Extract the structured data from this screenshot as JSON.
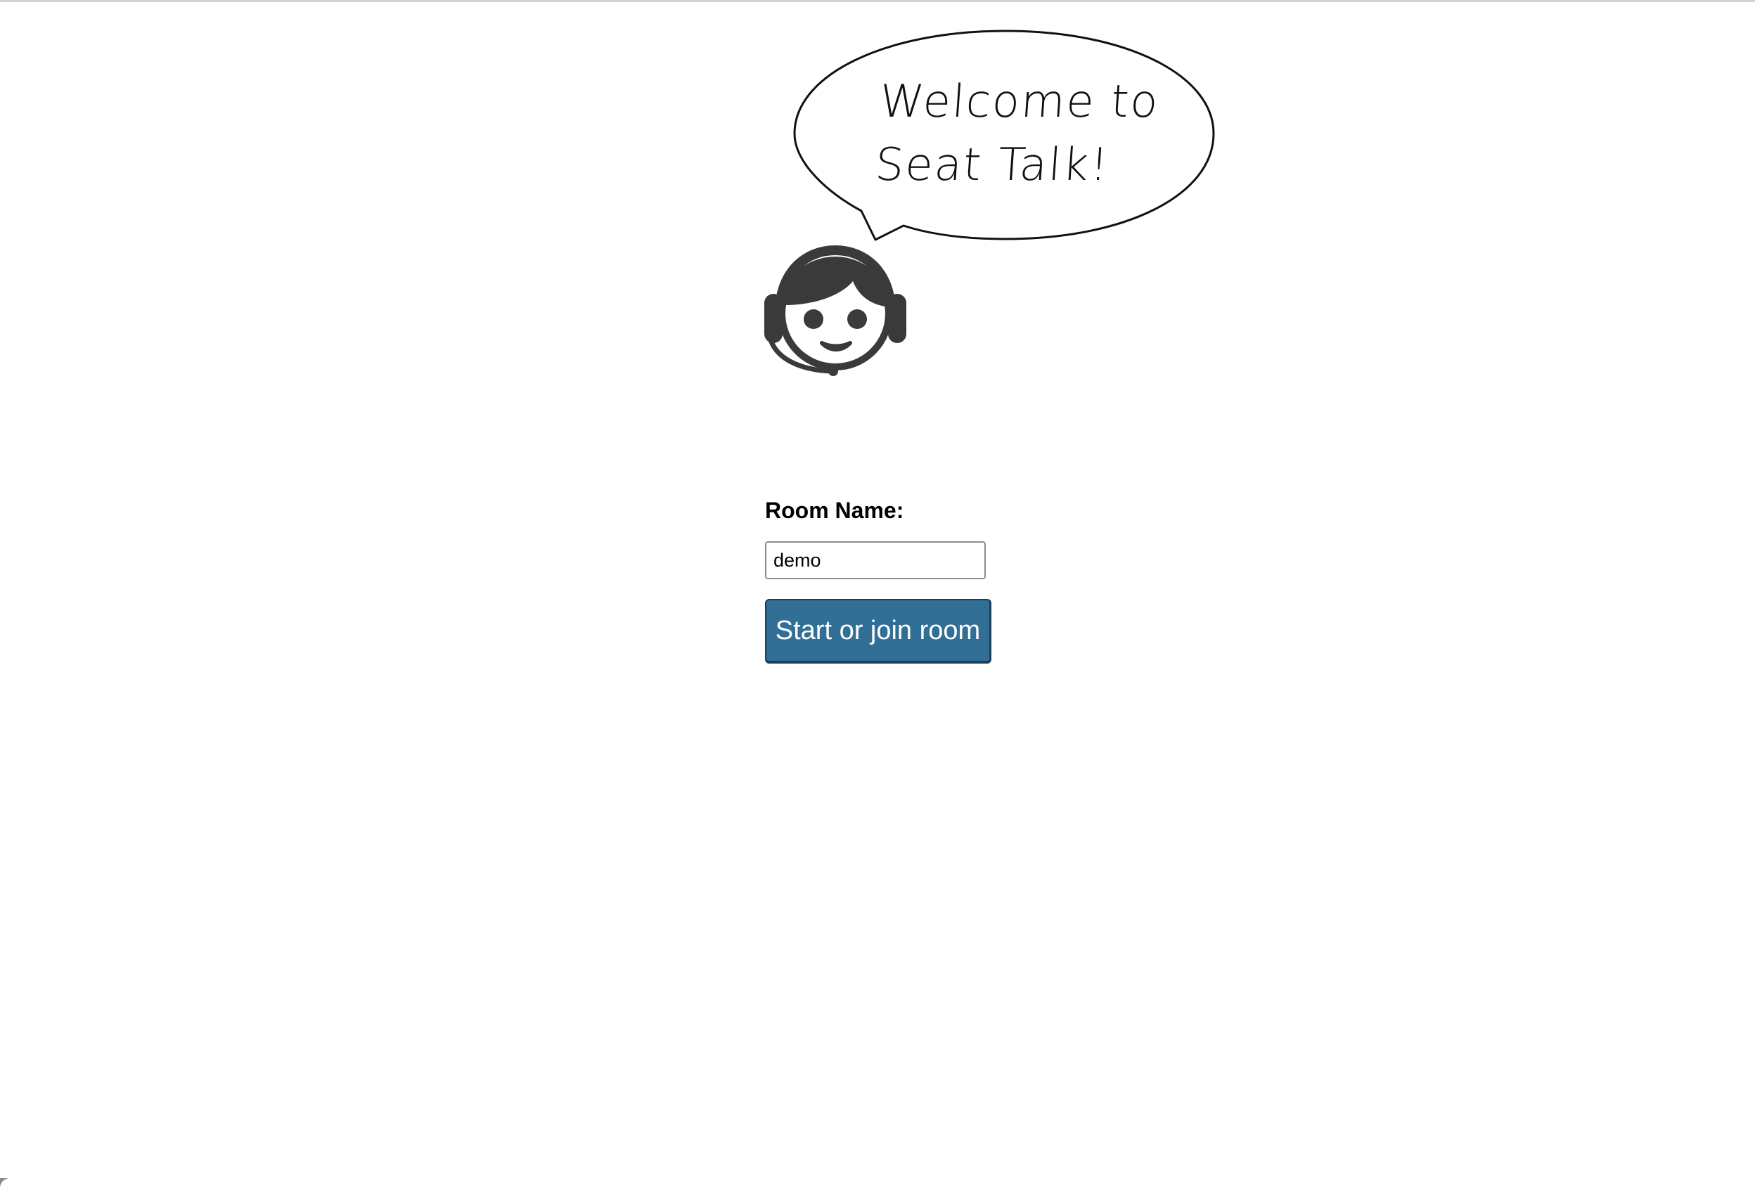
{
  "welcome": {
    "line1": "Welcome to",
    "line2": "Seat Talk!"
  },
  "avatar": {
    "icon": "support-agent-headset-icon",
    "color": "#3a3a3a"
  },
  "form": {
    "room_label": "Room Name:",
    "room_value": "demo",
    "start_button_label": "Start or join room"
  },
  "colors": {
    "button_bg": "#326f96",
    "button_text": "#ffffff"
  }
}
